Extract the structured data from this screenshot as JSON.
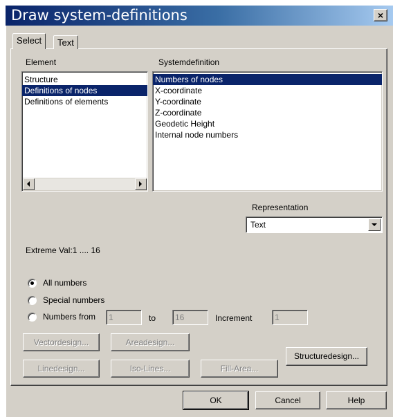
{
  "window": {
    "title": "Draw system-definitions",
    "close_label": "×"
  },
  "tabs": [
    {
      "label": "Select"
    },
    {
      "label": "Text"
    }
  ],
  "element": {
    "label": "Element",
    "items": [
      "Structure",
      "Definitions of nodes",
      "Definitions of elements"
    ],
    "selected_index": 1
  },
  "systemdefinition": {
    "label": "Systemdefinition",
    "items": [
      "Numbers of nodes",
      "X-coordinate",
      "Y-coordinate",
      "Z-coordinate",
      "Geodetic Height",
      "Internal node numbers"
    ],
    "selected_index": 0
  },
  "representation": {
    "label": "Representation",
    "value": "Text"
  },
  "extreme": {
    "text": "Extreme Val:1 .... 16"
  },
  "numbers": {
    "all_label": "All numbers",
    "special_label": "Special numbers",
    "from_label": "Numbers from",
    "selected": "all",
    "from_value": "1",
    "to_label": "to",
    "to_value": "16",
    "increment_label": "Increment",
    "increment_value": "1"
  },
  "design_buttons": {
    "vector": "Vectordesign...",
    "area": "Areadesign...",
    "line": "Linedesign...",
    "iso": "Iso-Lines...",
    "fill": "Fill-Area...",
    "structure": "Structuredesign..."
  },
  "footer": {
    "ok": "OK",
    "cancel": "Cancel",
    "help": "Help"
  }
}
